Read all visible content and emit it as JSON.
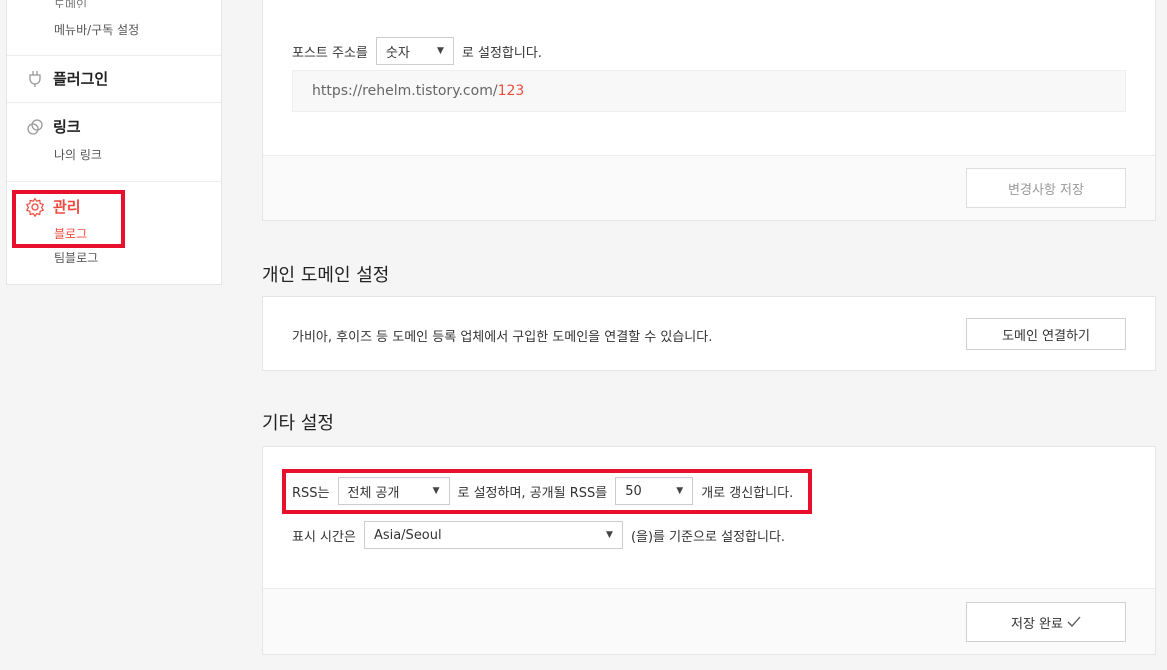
{
  "sidebar": {
    "cut_label": "도메인",
    "menubar_label": "메뉴바/구독 설정",
    "plugin_label": "플러그인",
    "link_label": "링크",
    "my_link_label": "나의 링크",
    "manage_label": "관리",
    "blog_label": "블로그",
    "teamblog_label": "팀블로그"
  },
  "post_address": {
    "prefix": "포스트 주소를",
    "select_value": "숫자",
    "suffix": "로 설정합니다.",
    "url_base": "https://rehelm.tistory.com/",
    "url_num": "123",
    "save_button": "변경사항 저장"
  },
  "domain_section": {
    "title": "개인 도메인 설정",
    "desc": "가비아, 후이즈 등 도메인 등록 업체에서 구입한 도메인을 연결할 수 있습니다.",
    "button": "도메인 연결하기"
  },
  "other_section": {
    "title": "기타 설정",
    "rss_prefix": "RSS는",
    "rss_select": "전체 공개",
    "rss_middle": "로 설정하며, 공개될 RSS를",
    "rss_count": "50",
    "rss_suffix": "개로 갱신합니다.",
    "time_prefix": "표시 시간은",
    "time_select": "Asia/Seoul",
    "time_suffix": "(을)를 기준으로 설정합니다.",
    "save_button": "저장 완료",
    "save_icon": "check-icon"
  },
  "colors": {
    "accent": "#ee4b3e",
    "highlight": "#e8112d"
  }
}
